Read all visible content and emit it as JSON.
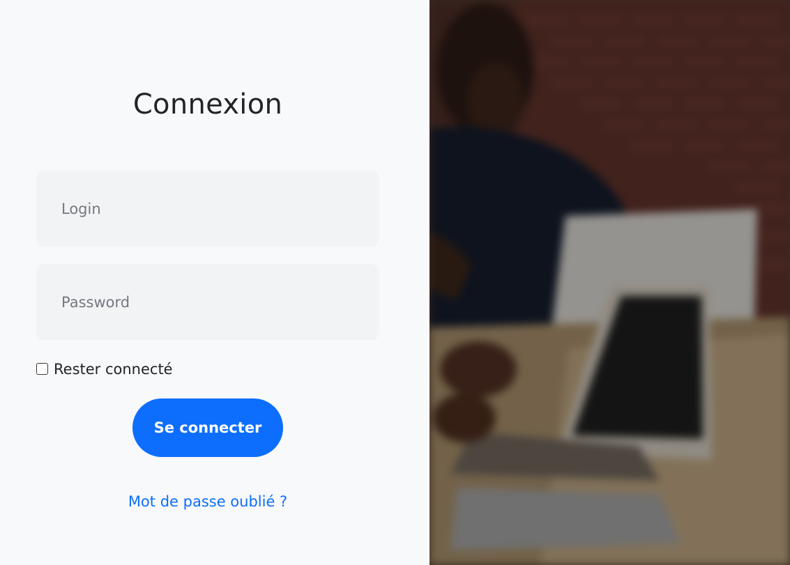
{
  "login_form": {
    "title": "Connexion",
    "login_placeholder": "Login",
    "password_placeholder": "Password",
    "remember_label": "Rester connecté",
    "remember_checked": false,
    "submit_label": "Se connecter",
    "forgot_link": "Mot de passe oublié ?"
  },
  "theme": {
    "primary": "#0d6efd",
    "panel_background": "#f8f9fa",
    "input_background": "#f2f3f5",
    "text": "#212529"
  },
  "background_image": {
    "subject": "blurred-office-meeting-photo"
  }
}
